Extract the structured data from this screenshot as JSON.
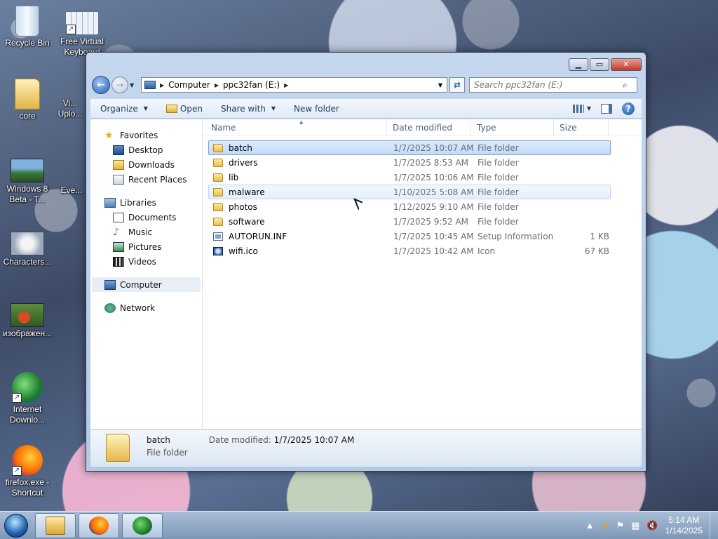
{
  "desktop": {
    "icons": [
      {
        "label": "Recycle Bin"
      },
      {
        "label": "Free Virtual Keyboard"
      },
      {
        "label": "core"
      },
      {
        "label": "Vi... Uplo..."
      },
      {
        "label": "Windows 8 Beta - T..."
      },
      {
        "label": "Eve..."
      },
      {
        "label": "Characters..."
      },
      {
        "label": "изображен..."
      },
      {
        "label": "Internet Downlo..."
      },
      {
        "label": "firefox.exe - Shortcut"
      }
    ]
  },
  "window": {
    "controls": {
      "minimize": "▁",
      "maximize": "▭",
      "close": "✕"
    },
    "address": {
      "crumbs": [
        "Computer",
        "ppc32fan (E:)"
      ]
    },
    "search": {
      "placeholder": "Search ppc32fan (E:)"
    },
    "toolbar": {
      "organize": "Organize",
      "open": "Open",
      "share_with": "Share with",
      "new_folder": "New folder"
    },
    "nav": {
      "favorites": {
        "label": "Favorites",
        "items": [
          "Desktop",
          "Downloads",
          "Recent Places"
        ]
      },
      "libraries": {
        "label": "Libraries",
        "items": [
          "Documents",
          "Music",
          "Pictures",
          "Videos"
        ]
      },
      "computer": "Computer",
      "network": "Network"
    },
    "columns": {
      "name": "Name",
      "date": "Date modified",
      "type": "Type",
      "size": "Size"
    },
    "files": [
      {
        "name": "batch",
        "date": "1/7/2025 10:07 AM",
        "type": "File folder",
        "size": "",
        "icon": "folder-icon",
        "state": "selected"
      },
      {
        "name": "drivers",
        "date": "1/7/2025 8:53 AM",
        "type": "File folder",
        "size": "",
        "icon": "folder-icon",
        "state": ""
      },
      {
        "name": "lib",
        "date": "1/7/2025 10:06 AM",
        "type": "File folder",
        "size": "",
        "icon": "folder-icon",
        "state": ""
      },
      {
        "name": "malware",
        "date": "1/10/2025 5:08 AM",
        "type": "File folder",
        "size": "",
        "icon": "folder-icon",
        "state": "hover"
      },
      {
        "name": "photos",
        "date": "1/12/2025 9:10 AM",
        "type": "File folder",
        "size": "",
        "icon": "folder-icon",
        "state": ""
      },
      {
        "name": "software",
        "date": "1/7/2025 9:52 AM",
        "type": "File folder",
        "size": "",
        "icon": "folder-icon",
        "state": ""
      },
      {
        "name": "AUTORUN.INF",
        "date": "1/7/2025 10:45 AM",
        "type": "Setup Information",
        "size": "1 KB",
        "icon": "inf-file-icon",
        "state": ""
      },
      {
        "name": "wifi.ico",
        "date": "1/7/2025 10:42 AM",
        "type": "Icon",
        "size": "67 KB",
        "icon": "ico-file-icon",
        "state": ""
      }
    ],
    "details": {
      "name": "batch",
      "type": "File folder",
      "date_label": "Date modified:",
      "date_value": "1/7/2025 10:07 AM"
    }
  },
  "taskbar": {
    "clock": {
      "time": "5:14 AM",
      "date": "1/14/2025"
    },
    "apps": [
      "windows-explorer",
      "firefox",
      "internet-download-manager"
    ]
  }
}
